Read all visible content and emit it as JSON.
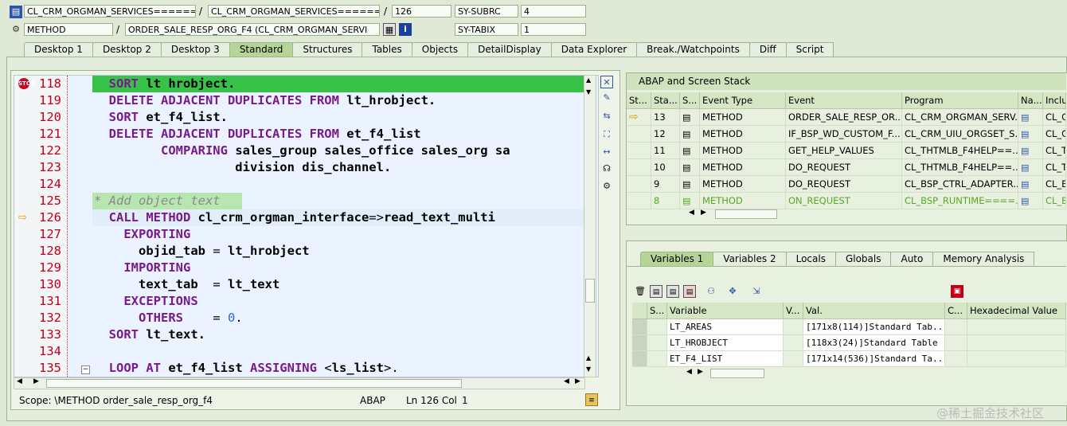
{
  "header": {
    "row1": {
      "program": "CL_CRM_ORGMAN_SERVICES=======",
      "include": "CL_CRM_ORGMAN_SERVICES=======",
      "line": "126",
      "sysfield": "SY-SUBRC",
      "sysvalue": "4"
    },
    "row2": {
      "kind": "METHOD",
      "name": "ORDER_SALE_RESP_ORG_F4 (CL_CRM_ORGMAN_SERVI",
      "sysfield": "SY-TABIX",
      "sysvalue": "1"
    }
  },
  "tabs": [
    "Desktop 1",
    "Desktop 2",
    "Desktop 3",
    "Standard",
    "Structures",
    "Tables",
    "Objects",
    "DetailDisplay",
    "Data Explorer",
    "Break./Watchpoints",
    "Diff",
    "Script"
  ],
  "active_tab": "Standard",
  "code": {
    "lines": [
      {
        "n": "118",
        "t": "  SORT lt hrobject."
      },
      {
        "n": "119",
        "t": "  DELETE ADJACENT DUPLICATES FROM lt_hrobject."
      },
      {
        "n": "120",
        "t": "  SORT et_f4_list."
      },
      {
        "n": "121",
        "t": "  DELETE ADJACENT DUPLICATES FROM et_f4_list"
      },
      {
        "n": "122",
        "t": "         COMPARING sales_group sales_office sales_org sa"
      },
      {
        "n": "123",
        "t": "                   division dis_channel."
      },
      {
        "n": "124",
        "t": ""
      },
      {
        "n": "125",
        "t": "* Add object text"
      },
      {
        "n": "126",
        "t": "  CALL METHOD cl_crm_orgman_interface=>read_text_multi"
      },
      {
        "n": "127",
        "t": "    EXPORTING"
      },
      {
        "n": "128",
        "t": "      objid_tab = lt_hrobject"
      },
      {
        "n": "129",
        "t": "    IMPORTING"
      },
      {
        "n": "130",
        "t": "      text_tab  = lt_text"
      },
      {
        "n": "131",
        "t": "    EXCEPTIONS"
      },
      {
        "n": "132",
        "t": "      OTHERS    = 0."
      },
      {
        "n": "133",
        "t": "  SORT lt_text."
      },
      {
        "n": "134",
        "t": ""
      },
      {
        "n": "135",
        "t": "  LOOP AT et_f4_list ASSIGNING <ls_list>."
      }
    ],
    "current_line": "126",
    "executed_line": "118"
  },
  "status": {
    "scope": "Scope: \\METHOD order_sale_resp_org_f4",
    "lang": "ABAP",
    "pos": "Ln 126 Col",
    "col": "1"
  },
  "stack": {
    "title": "ABAP and Screen Stack",
    "columns": [
      "St...",
      "Sta...",
      "S...",
      "Event Type",
      "Event",
      "Program",
      "Na...",
      "Inclu"
    ],
    "rows": [
      {
        "level": "13",
        "type": "METHOD",
        "event": "ORDER_SALE_RESP_OR...",
        "program": "CL_CRM_ORGMAN_SERV...",
        "incl": "CL_C",
        "current": true
      },
      {
        "level": "12",
        "type": "METHOD",
        "event": "IF_BSP_WD_CUSTOM_F...",
        "program": "CL_CRM_UIU_ORGSET_S...",
        "incl": "CL_C"
      },
      {
        "level": "11",
        "type": "METHOD",
        "event": "GET_HELP_VALUES",
        "program": "CL_THTMLB_F4HELP==...",
        "incl": "CL_T"
      },
      {
        "level": "10",
        "type": "METHOD",
        "event": "DO_REQUEST",
        "program": "CL_THTMLB_F4HELP==...",
        "incl": "CL_T"
      },
      {
        "level": "9",
        "type": "METHOD",
        "event": "DO_REQUEST",
        "program": "CL_BSP_CTRL_ADAPTER...",
        "incl": "CL_B"
      },
      {
        "level": "8",
        "type": "METHOD",
        "event": "ON_REQUEST",
        "program": "CL_BSP_RUNTIME====...",
        "incl": "CL_B",
        "green": true
      }
    ]
  },
  "var_tabs": [
    "Variables 1",
    "Variables 2",
    "Locals",
    "Globals",
    "Auto",
    "Memory Analysis"
  ],
  "var_active": "Variables 1",
  "vars": {
    "columns": [
      "S...",
      "Variable",
      "V...",
      "Val.",
      "C...",
      "Hexadecimal Value"
    ],
    "rows": [
      {
        "name": "LT_AREAS",
        "val": "[171x8(114)]Standard Tab..."
      },
      {
        "name": "LT_HROBJECT",
        "val": "[118x3(24)]Standard Table"
      },
      {
        "name": "ET_F4_LIST",
        "val": "[171x14(536)]Standard Ta..."
      }
    ]
  },
  "watermark": "@稀土掘金技术社区"
}
